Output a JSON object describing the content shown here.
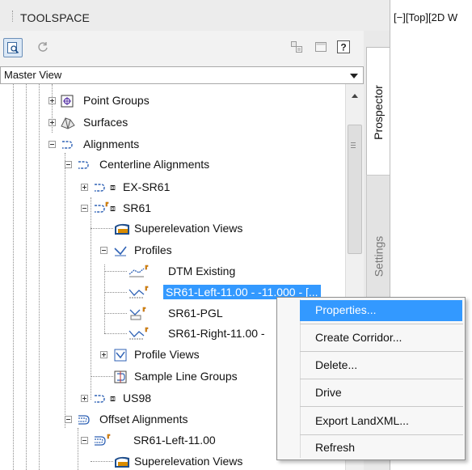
{
  "viewport": {
    "label": "[−][Top][2D W"
  },
  "toolspace": {
    "title": "TOOLSPACE",
    "view_select": "Master View",
    "help_glyph": "?",
    "tabs": [
      "Prospector",
      "Settings"
    ]
  },
  "tree": {
    "items": [
      {
        "label": "Point Groups",
        "icon": "point-groups-icon"
      },
      {
        "label": "Surfaces",
        "icon": "surfaces-icon"
      },
      {
        "label": "Alignments",
        "icon": "alignment-icon"
      },
      {
        "label": "Centerline Alignments",
        "icon": "alignment-icon"
      },
      {
        "label": "EX-SR61",
        "icon": "alignment-icon",
        "badge": "⧈"
      },
      {
        "label": "SR61",
        "icon": "alignment-icon",
        "badge": "⧈"
      },
      {
        "label": "Superelevation Views",
        "icon": "superelevation-icon"
      },
      {
        "label": "Profiles",
        "icon": "profile-icon"
      },
      {
        "label": "DTM Existing",
        "icon": "profile-icon"
      },
      {
        "label": "SR61-Left-11.00 - -11.000 - [...",
        "icon": "profile-icon",
        "selected": true
      },
      {
        "label": "SR61-PGL",
        "icon": "profile-icon"
      },
      {
        "label": "SR61-Right-11.00 -",
        "icon": "profile-icon"
      },
      {
        "label": "Profile Views",
        "icon": "profile-view-icon"
      },
      {
        "label": "Sample Line Groups",
        "icon": "sample-line-icon"
      },
      {
        "label": "US98",
        "icon": "alignment-icon",
        "badge": "⧈"
      },
      {
        "label": "Offset Alignments",
        "icon": "offset-alignment-icon"
      },
      {
        "label": "SR61-Left-11.00",
        "icon": "offset-alignment-icon"
      },
      {
        "label": "Superelevation Views",
        "icon": "superelevation-icon"
      }
    ]
  },
  "context_menu": {
    "items": [
      "Properties...",
      "Create Corridor...",
      "Delete...",
      "Drive",
      "Export LandXML...",
      "Refresh"
    ]
  },
  "colors": {
    "selection": "#3399ff",
    "menu_bg": "#f7f7f7",
    "panel_bg": "#f2f2f2"
  }
}
